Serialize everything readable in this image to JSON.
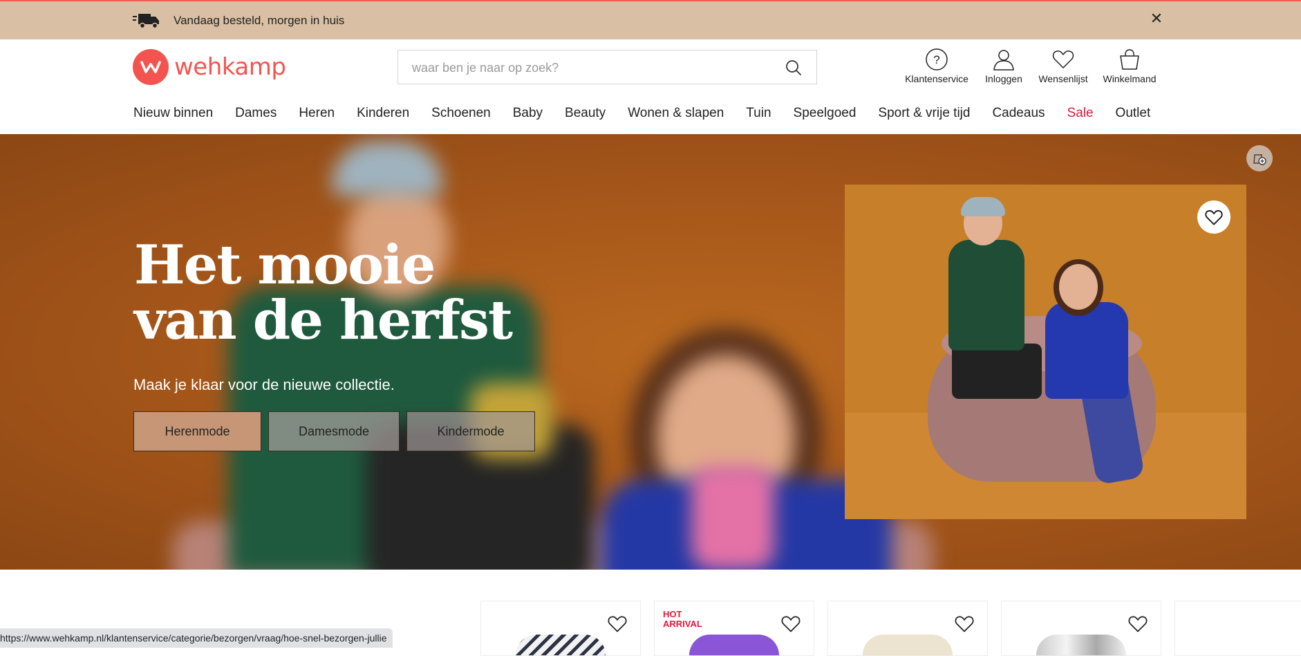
{
  "promo": {
    "text": "Vandaag besteld, morgen in huis",
    "icon": "truck-icon",
    "close_icon": "close-icon"
  },
  "header": {
    "logo_text": "wehkamp",
    "search_placeholder": "waar ben je naar op zoek?",
    "actions": [
      {
        "label": "Klantenservice",
        "icon": "help-icon"
      },
      {
        "label": "Inloggen",
        "icon": "user-icon"
      },
      {
        "label": "Wensenlijst",
        "icon": "heart-icon"
      },
      {
        "label": "Winkelmand",
        "icon": "bag-icon"
      }
    ]
  },
  "nav": {
    "items": [
      "Nieuw binnen",
      "Dames",
      "Heren",
      "Kinderen",
      "Schoenen",
      "Baby",
      "Beauty",
      "Wonen & slapen",
      "Tuin",
      "Speelgoed",
      "Sport & vrije tijd",
      "Cadeaus",
      "Sale",
      "Outlet"
    ],
    "sale_color": "#e0183b"
  },
  "hero": {
    "title_line1": "Het mooie",
    "title_line2": "van de herfst",
    "subtitle": "Maak je klaar voor de nieuwe collectie.",
    "buttons": [
      "Herenmode",
      "Damesmode",
      "Kindermode"
    ]
  },
  "products": {
    "hot_badge_line1": "HOT",
    "hot_badge_line2": "ARRIVAL"
  },
  "status_url": "https://www.wehkamp.nl/klantenservice/categorie/bezorgen/vraag/hoe-snel-bezorgen-jullie",
  "colors": {
    "brand": "#f35450",
    "promo_bg": "#d9bfa3",
    "hero_bg": "#a6571a"
  }
}
